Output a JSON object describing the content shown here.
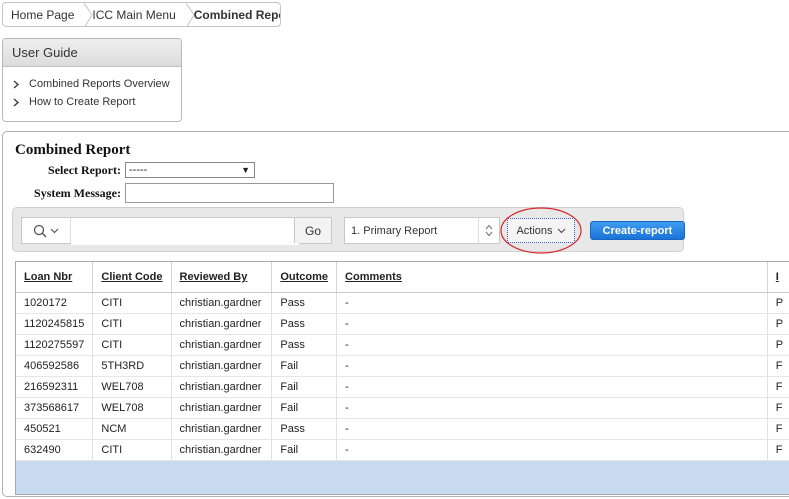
{
  "breadcrumb": [
    "Home Page",
    "ICC Main Menu",
    "Combined Report"
  ],
  "user_guide": {
    "title": "User Guide",
    "items": [
      "Combined Reports Overview",
      "How to Create Report"
    ]
  },
  "region": {
    "title": "Combined Report",
    "select_report_label": "Select Report:",
    "select_report_value": "-----",
    "system_message_label": "System Message:",
    "system_message_value": ""
  },
  "toolbar": {
    "search_value": "",
    "go_label": "Go",
    "report_select_value": "1. Primary Report",
    "actions_label": "Actions",
    "create_label": "Create-report"
  },
  "table": {
    "columns": [
      "Loan Nbr",
      "Client Code",
      "Reviewed By",
      "Outcome",
      "Comments",
      "I"
    ],
    "rows": [
      [
        "1020172",
        "CITI",
        "christian.gardner",
        "Pass",
        "-",
        "P"
      ],
      [
        "1120245815",
        "CITI",
        "christian.gardner",
        "Pass",
        "-",
        "P"
      ],
      [
        "1120275597",
        "CITI",
        "christian.gardner",
        "Pass",
        "-",
        "P"
      ],
      [
        "406592586",
        "5TH3RD",
        "christian.gardner",
        "Fail",
        "-",
        "F"
      ],
      [
        "216592311",
        "WEL708",
        "christian.gardner",
        "Fail",
        "-",
        "F"
      ],
      [
        "373568617",
        "WEL708",
        "christian.gardner",
        "Fail",
        "-",
        "F"
      ],
      [
        "450521",
        "NCM",
        "christian.gardner",
        "Pass",
        "-",
        "F"
      ],
      [
        "632490",
        "CITI",
        "christian.gardner",
        "Fail",
        "-",
        "F"
      ]
    ]
  },
  "colors": {
    "create_button": "#1a73d8",
    "highlight_ellipse": "#d9222a",
    "table_footer": "#c8daf0"
  }
}
